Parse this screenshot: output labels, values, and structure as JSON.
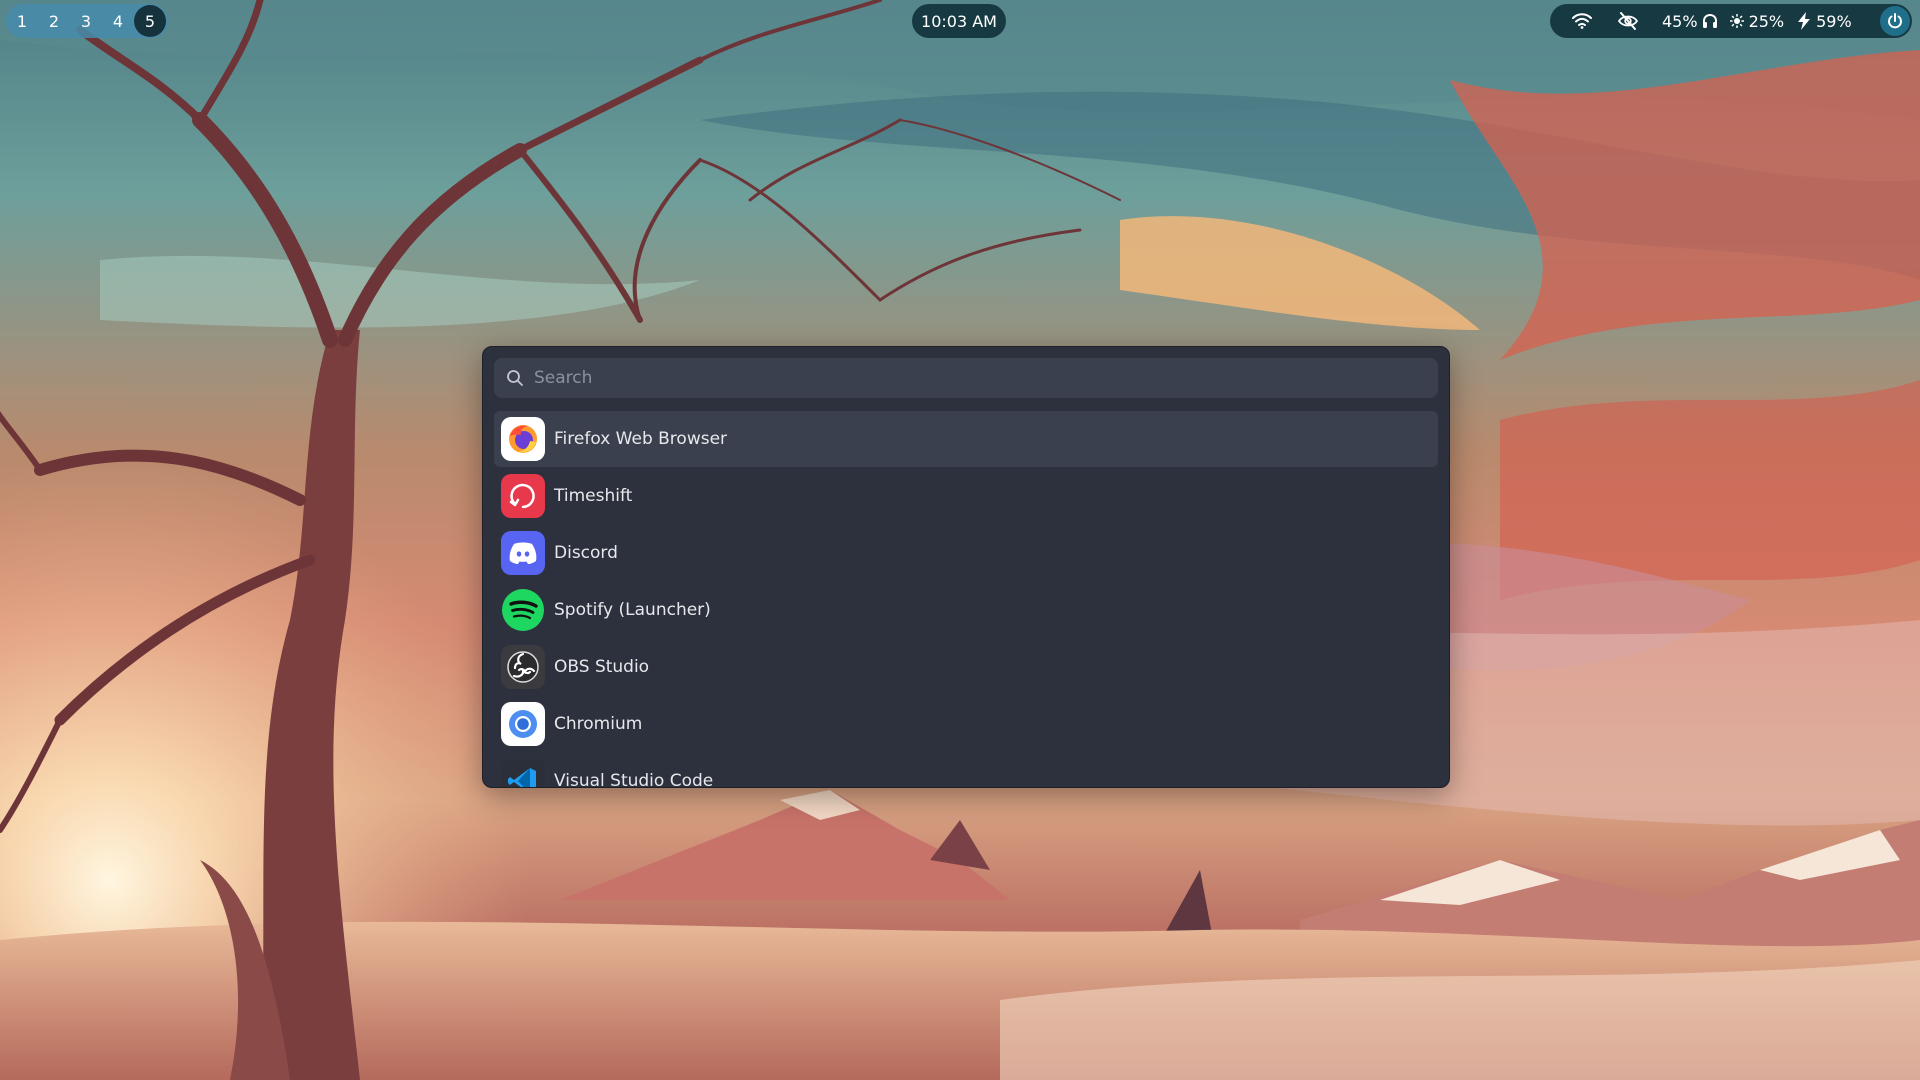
{
  "topbar": {
    "workspaces": [
      {
        "label": "1",
        "active": false
      },
      {
        "label": "2",
        "active": false
      },
      {
        "label": "3",
        "active": false
      },
      {
        "label": "4",
        "active": false
      },
      {
        "label": "5",
        "active": true
      }
    ],
    "clock": "10:03 AM",
    "tray": {
      "wifi_icon": "wifi-icon",
      "hidden_icon": "eye-off-icon",
      "volume": "45%",
      "headphones_icon": "headphones-icon",
      "brightness_icon": "sun-icon",
      "brightness": "25%",
      "battery_icon": "bolt-icon",
      "battery": "59%",
      "power_icon": "power-icon"
    }
  },
  "launcher": {
    "search": {
      "placeholder": "Search",
      "value": ""
    },
    "items": [
      {
        "label": "Firefox Web Browser",
        "icon": "firefox-icon",
        "selected": true
      },
      {
        "label": "Timeshift",
        "icon": "timeshift-icon",
        "selected": false
      },
      {
        "label": "Discord",
        "icon": "discord-icon",
        "selected": false
      },
      {
        "label": "Spotify (Launcher)",
        "icon": "spotify-icon",
        "selected": false
      },
      {
        "label": "OBS Studio",
        "icon": "obs-icon",
        "selected": false
      },
      {
        "label": "Chromium",
        "icon": "chromium-icon",
        "selected": false
      },
      {
        "label": "Visual Studio Code",
        "icon": "vscode-icon",
        "selected": false
      }
    ]
  },
  "colors": {
    "panel": "#2c313d",
    "search_bg": "#3a404d",
    "bar_bg": "#173a42",
    "workspace_group": "#468caa",
    "text": "#e6e8ec"
  }
}
